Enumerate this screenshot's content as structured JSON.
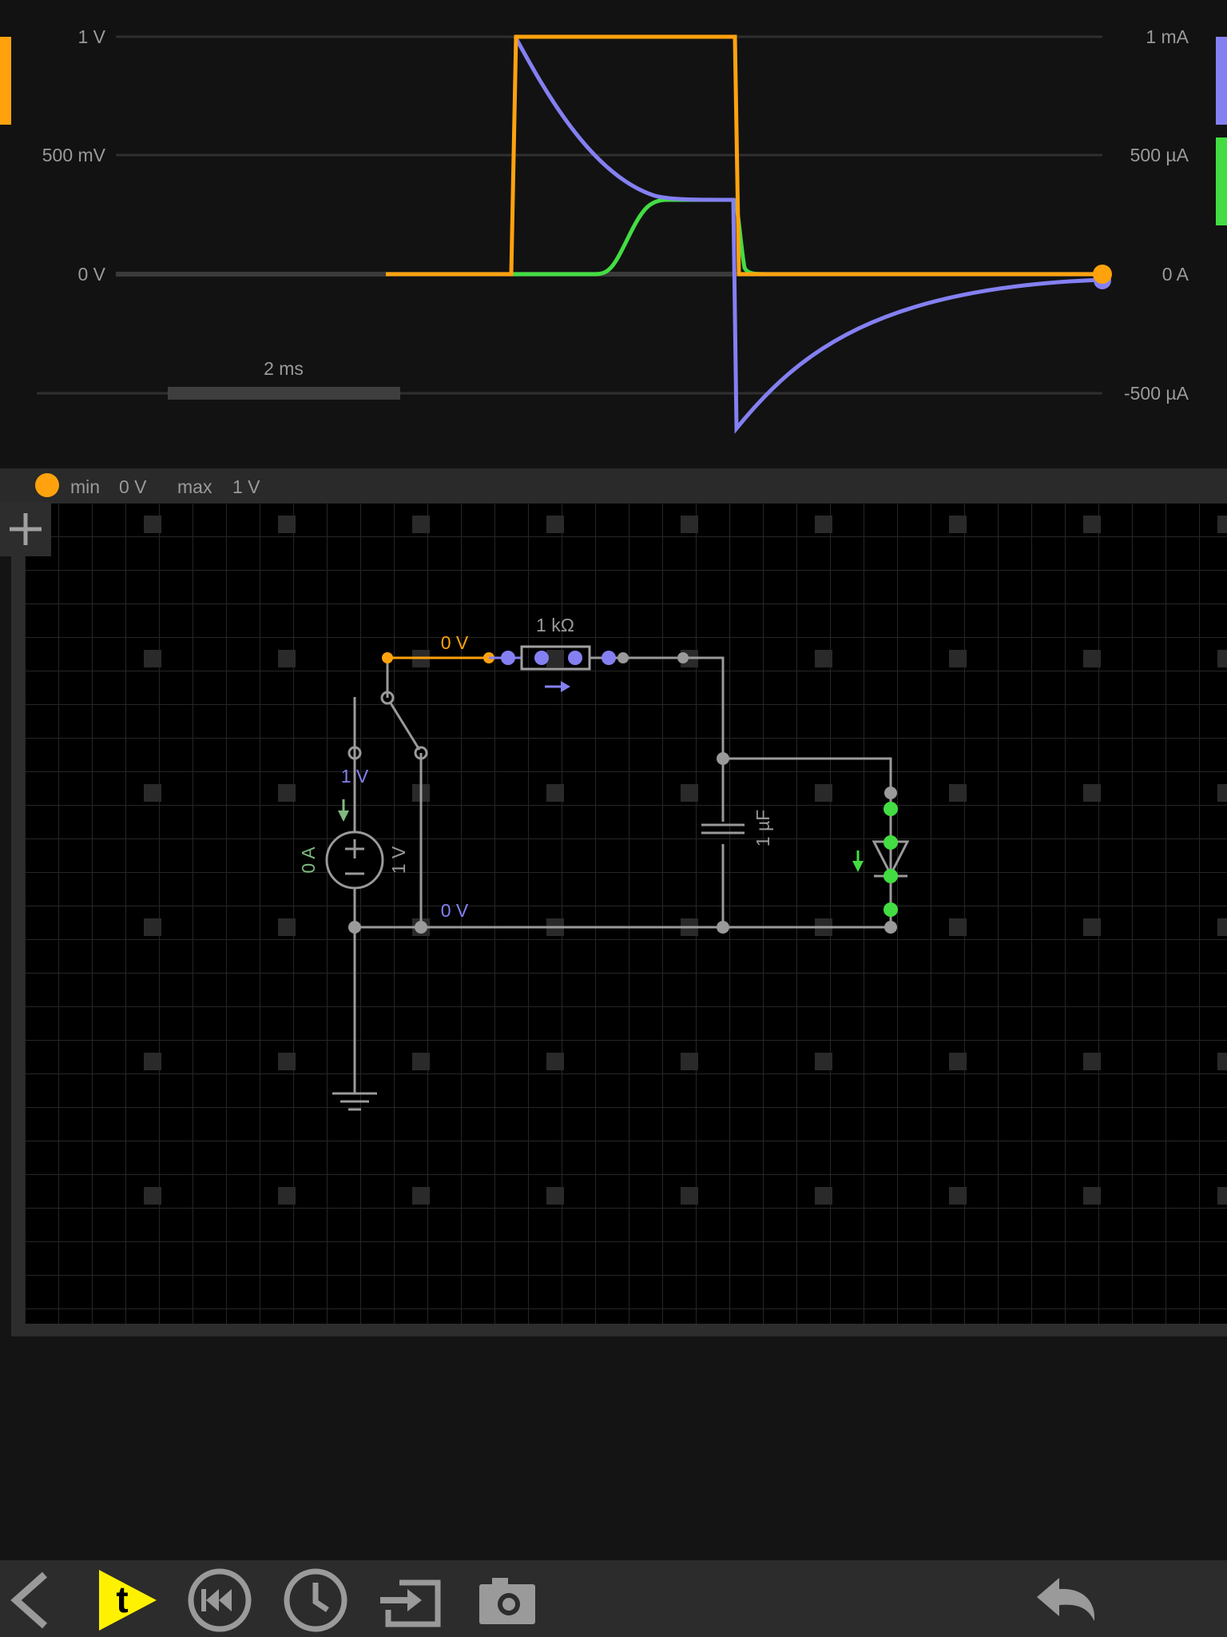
{
  "scope": {
    "left_axis": {
      "top": "1 V",
      "mid": "500 mV",
      "zero": "0 V"
    },
    "right_axis": {
      "top": "1 mA",
      "mid": "500 µA",
      "zero": "0 A",
      "neg": "-500 µA"
    },
    "time_scale": "2 ms",
    "trace_colors": {
      "voltage": "#FFA20E",
      "current": "#8480F2",
      "diode": "#43DD43"
    }
  },
  "probe_bar": {
    "min_label": "min",
    "min_value": "0 V",
    "max_label": "max",
    "max_value": "1 V"
  },
  "circuit": {
    "wire_top_voltage": "0 V",
    "resistor_value": "1 kΩ",
    "source_top_voltage": "1 V",
    "source_current": "0 A",
    "source_voltage": "1 V",
    "wire_bottom_voltage": "0 V",
    "capacitor_value": "1 µF"
  },
  "toolbar": {
    "back": "chevron-left-icon",
    "play": "play-t-icon",
    "rewind": "rewind-icon",
    "clock": "clock-icon",
    "export": "export-icon",
    "camera": "camera-icon",
    "undo": "undo-icon"
  }
}
